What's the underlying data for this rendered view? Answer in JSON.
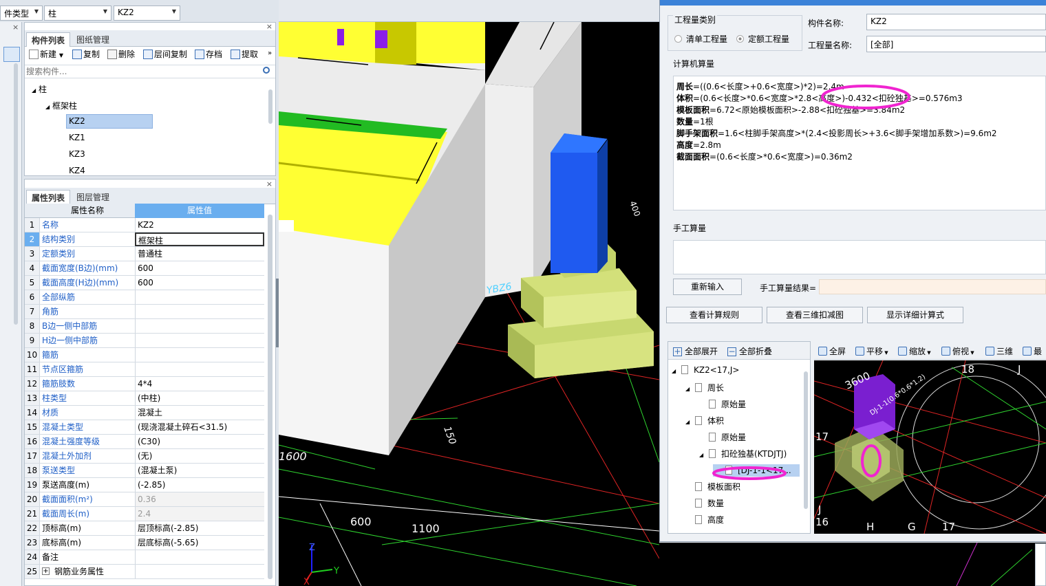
{
  "topbar": {
    "combo1": "件类型",
    "combo2": "柱",
    "combo3": "KZ2"
  },
  "component_panel": {
    "tabs": [
      "构件列表",
      "图纸管理"
    ],
    "toolbar": [
      "新建",
      "复制",
      "删除",
      "层间复制",
      "存档",
      "提取"
    ],
    "search_placeholder": "搜索构件...",
    "tree": {
      "root": "柱",
      "group": "框架柱",
      "items": [
        "KZ2",
        "KZ1",
        "KZ3",
        "KZ4"
      ]
    }
  },
  "property_panel": {
    "tabs": [
      "属性列表",
      "图层管理"
    ],
    "header": {
      "name": "属性名称",
      "value": "属性值"
    },
    "rows": [
      {
        "n": "1",
        "k": "名称",
        "v": "KZ2"
      },
      {
        "n": "2",
        "k": "结构类别",
        "v": "框架柱"
      },
      {
        "n": "3",
        "k": "定额类别",
        "v": "普通柱"
      },
      {
        "n": "4",
        "k": "截面宽度(B边)(mm)",
        "v": "600"
      },
      {
        "n": "5",
        "k": "截面高度(H边)(mm)",
        "v": "600"
      },
      {
        "n": "6",
        "k": "全部纵筋",
        "v": ""
      },
      {
        "n": "7",
        "k": "角筋",
        "v": ""
      },
      {
        "n": "8",
        "k": "B边一侧中部筋",
        "v": ""
      },
      {
        "n": "9",
        "k": "H边一侧中部筋",
        "v": ""
      },
      {
        "n": "10",
        "k": "箍筋",
        "v": ""
      },
      {
        "n": "11",
        "k": "节点区箍筋",
        "v": ""
      },
      {
        "n": "12",
        "k": "箍筋肢数",
        "v": "4*4"
      },
      {
        "n": "13",
        "k": "柱类型",
        "v": "(中柱)"
      },
      {
        "n": "14",
        "k": "材质",
        "v": "混凝土"
      },
      {
        "n": "15",
        "k": "混凝土类型",
        "v": "(现浇混凝土碎石<31.5)"
      },
      {
        "n": "16",
        "k": "混凝土强度等级",
        "v": "(C30)"
      },
      {
        "n": "17",
        "k": "混凝土外加剂",
        "v": "(无)"
      },
      {
        "n": "18",
        "k": "泵送类型",
        "v": "(混凝土泵)"
      },
      {
        "n": "19",
        "k": "泵送高度(m)",
        "v": "(-2.85)"
      },
      {
        "n": "20",
        "k": "截面面积(m²)",
        "v": "0.36"
      },
      {
        "n": "21",
        "k": "截面周长(m)",
        "v": "2.4"
      },
      {
        "n": "22",
        "k": "顶标高(m)",
        "v": "层顶标高(-2.85)"
      },
      {
        "n": "23",
        "k": "底标高(m)",
        "v": "层底标高(-5.65)"
      },
      {
        "n": "24",
        "k": "备注",
        "v": ""
      },
      {
        "n": "25",
        "k": "钢筋业务属性",
        "v": ""
      }
    ]
  },
  "viewport": {
    "labels": [
      "YBZ6",
      "1600",
      "150",
      "600",
      "1100",
      "400"
    ],
    "axis": {
      "z": "Z",
      "y": "Y",
      "x": "X"
    }
  },
  "dialog": {
    "qty_type_label": "工程量类别",
    "radio1": "清单工程量",
    "radio2": "定额工程量",
    "comp_name_label": "构件名称:",
    "comp_name_value": "KZ2",
    "qty_name_label": "工程量名称:",
    "qty_name_value": "[全部]",
    "calc_label": "计算机算量",
    "calc_lines": [
      {
        "b": "周长",
        "t": "=((0.6<长度>+0.6<宽度>)*2)=2.4m"
      },
      {
        "b": "体积",
        "t": "=(0.6<长度>*0.6<宽度>*2.8<高度>)-0.432<扣砼独基>=0.576m3"
      },
      {
        "b": "模板面积",
        "t": "=6.72<原始模板面积>-2.88<扣砼独基>=3.84m2"
      },
      {
        "b": "数量",
        "t": "=1根"
      },
      {
        "b": "脚手架面积",
        "t": "=1.6<柱脚手架高度>*(2.4<投影周长>+3.6<脚手架增加系数>)=9.6m2"
      },
      {
        "b": "高度",
        "t": "=2.8m"
      },
      {
        "b": "截面面积",
        "t": "=(0.6<长度>*0.6<宽度>)=0.36m2"
      }
    ],
    "manual_label": "手工算量",
    "reinput_btn": "重新输入",
    "manual_result_label": "手工算量结果=",
    "btn_rules": "查看计算规则",
    "btn_3d": "查看三维扣减图",
    "btn_detail": "显示详细计算式",
    "expand_all": "全部展开",
    "collapse_all": "全部折叠",
    "tree": [
      {
        "t": "KZ2<17,J>",
        "lvl": 0
      },
      {
        "t": "周长",
        "lvl": 1
      },
      {
        "t": "原始量",
        "lvl": 2
      },
      {
        "t": "体积",
        "lvl": 1
      },
      {
        "t": "原始量",
        "lvl": 2
      },
      {
        "t": "扣砼独基(KTDJTJ)",
        "lvl": 2
      },
      {
        "t": "[DJ-1-1<17...",
        "lvl": 3
      },
      {
        "t": "模板面积",
        "lvl": 1
      },
      {
        "t": "数量",
        "lvl": 1
      },
      {
        "t": "高度",
        "lvl": 1
      }
    ],
    "view_toolbar": [
      "全屏",
      "平移",
      "缩放",
      "俯视",
      "三维",
      "最"
    ],
    "preview_labels": [
      "3600",
      "DJ-1-1(0.6*0.6*1.2)",
      "18",
      "J",
      "17",
      "J",
      "16",
      "H",
      "G",
      "17"
    ]
  }
}
